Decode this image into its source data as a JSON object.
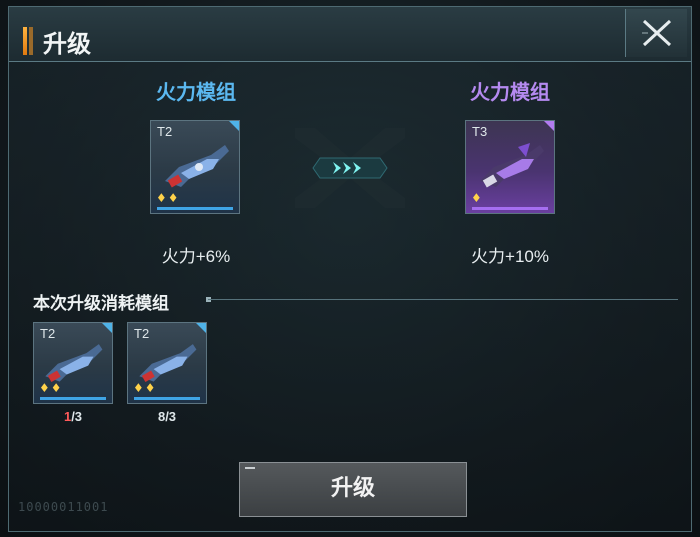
{
  "header": {
    "title": "升级",
    "close_icon": "close-icon"
  },
  "current": {
    "name": "火力模组",
    "tier": "T2",
    "stars": "♦♦",
    "stat": "火力+6%",
    "name_color": "#5bb8f0"
  },
  "next": {
    "name": "火力模组",
    "tier": "T3",
    "stars": "♦",
    "stat": "火力+10%",
    "name_color": "#b58af0"
  },
  "consume": {
    "label": "本次升级消耗模组",
    "items": [
      {
        "tier": "T2",
        "stars": "♦♦",
        "have": "1",
        "need": "/3"
      },
      {
        "tier": "T2",
        "stars": "♦♦",
        "have": "8",
        "need": "/3"
      }
    ]
  },
  "button": {
    "label": "升级"
  },
  "deco": {
    "code": "10000011001"
  },
  "colors": {
    "accent_blue": "#3fa4e6",
    "accent_purple": "#a56ef0",
    "deficit_red": "#ff5a5a"
  }
}
